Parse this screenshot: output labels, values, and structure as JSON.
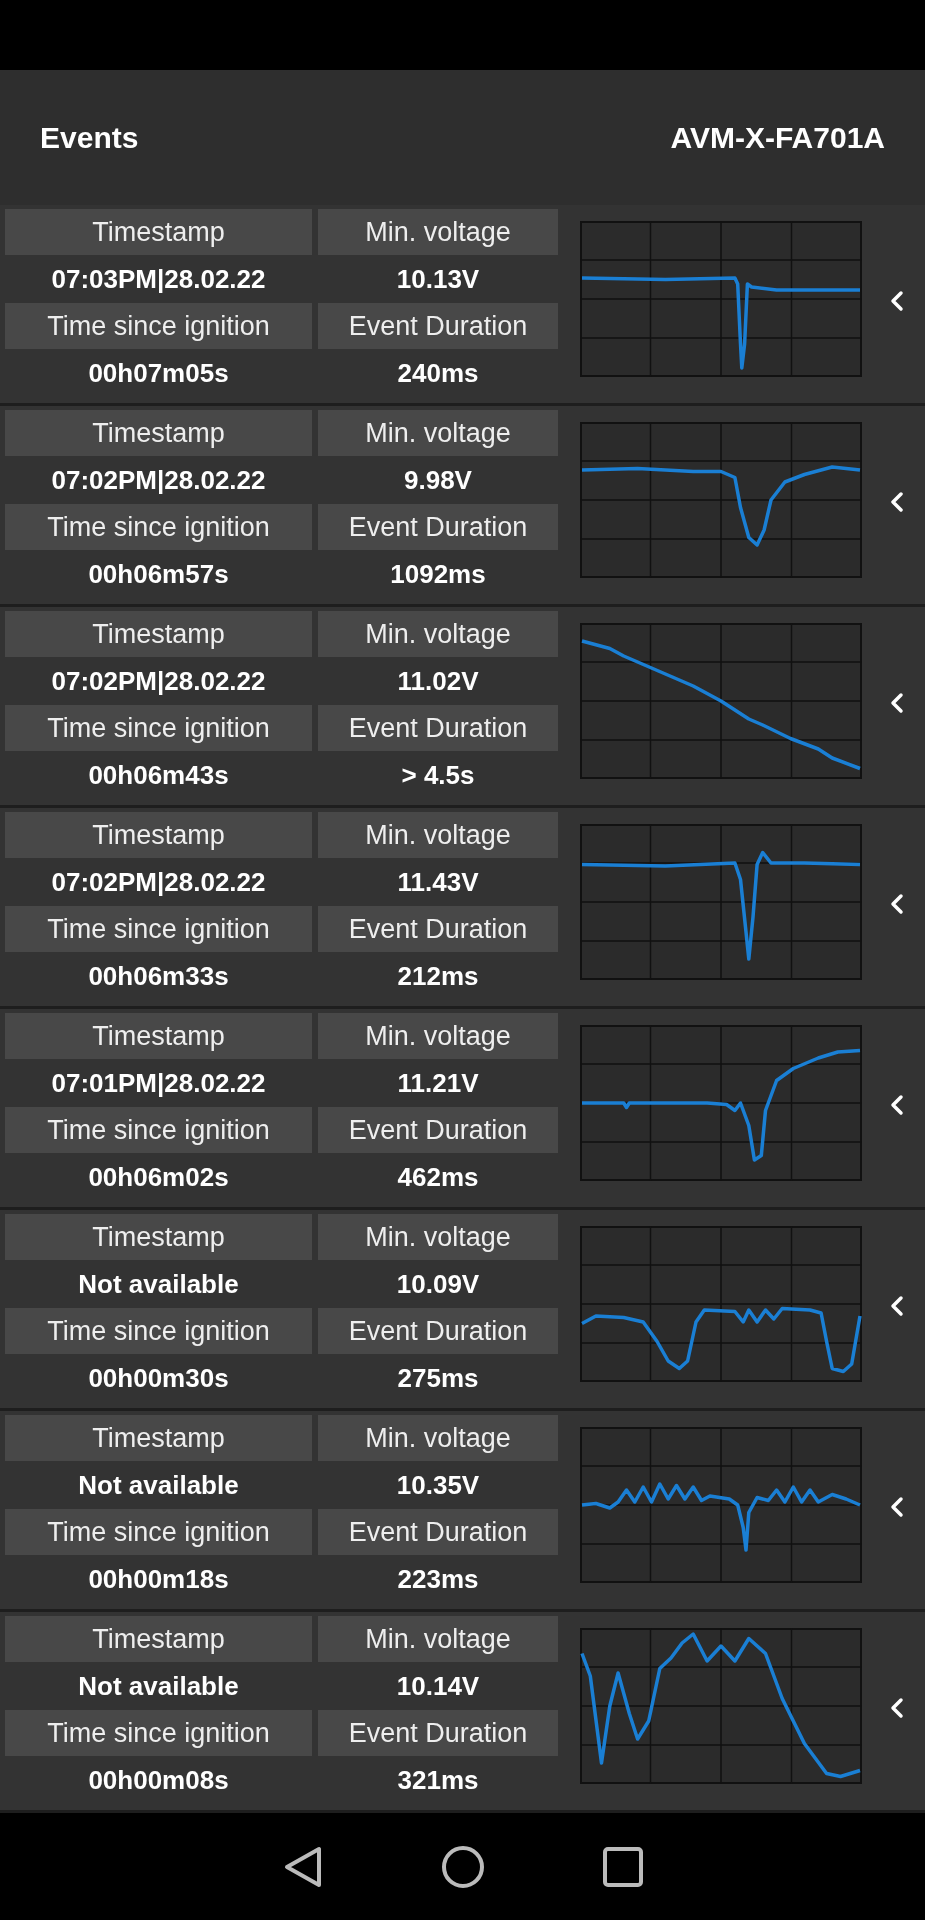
{
  "header": {
    "title": "Events",
    "device": "AVM-X-FA701A"
  },
  "events": [
    {
      "timestamp_label": "Timestamp",
      "timestamp": "07:03PM|28.02.22",
      "voltage_label": "Min. voltage",
      "voltage": "10.13V",
      "ignition_label": "Time since ignition",
      "ignition": "00h07m05s",
      "duration_label": "Event Duration",
      "duration": "240ms"
    },
    {
      "timestamp_label": "Timestamp",
      "timestamp": "07:02PM|28.02.22",
      "voltage_label": "Min. voltage",
      "voltage": "9.98V",
      "ignition_label": "Time since ignition",
      "ignition": "00h06m57s",
      "duration_label": "Event Duration",
      "duration": "1092ms"
    },
    {
      "timestamp_label": "Timestamp",
      "timestamp": "07:02PM|28.02.22",
      "voltage_label": "Min. voltage",
      "voltage": "11.02V",
      "ignition_label": "Time since ignition",
      "ignition": "00h06m43s",
      "duration_label": "Event Duration",
      "duration": "> 4.5s"
    },
    {
      "timestamp_label": "Timestamp",
      "timestamp": "07:02PM|28.02.22",
      "voltage_label": "Min. voltage",
      "voltage": "11.43V",
      "ignition_label": "Time since ignition",
      "ignition": "00h06m33s",
      "duration_label": "Event Duration",
      "duration": "212ms"
    },
    {
      "timestamp_label": "Timestamp",
      "timestamp": "07:01PM|28.02.22",
      "voltage_label": "Min. voltage",
      "voltage": "11.21V",
      "ignition_label": "Time since ignition",
      "ignition": "00h06m02s",
      "duration_label": "Event Duration",
      "duration": "462ms"
    },
    {
      "timestamp_label": "Timestamp",
      "timestamp": "Not available",
      "voltage_label": "Min. voltage",
      "voltage": "10.09V",
      "ignition_label": "Time since ignition",
      "ignition": "00h00m30s",
      "duration_label": "Event Duration",
      "duration": "275ms"
    },
    {
      "timestamp_label": "Timestamp",
      "timestamp": "Not available",
      "voltage_label": "Min. voltage",
      "voltage": "10.35V",
      "ignition_label": "Time since ignition",
      "ignition": "00h00m18s",
      "duration_label": "Event Duration",
      "duration": "223ms"
    },
    {
      "timestamp_label": "Timestamp",
      "timestamp": "Not available",
      "voltage_label": "Min. voltage",
      "voltage": "10.14V",
      "ignition_label": "Time since ignition",
      "ignition": "00h00m08s",
      "duration_label": "Event Duration",
      "duration": "321ms"
    }
  ]
}
